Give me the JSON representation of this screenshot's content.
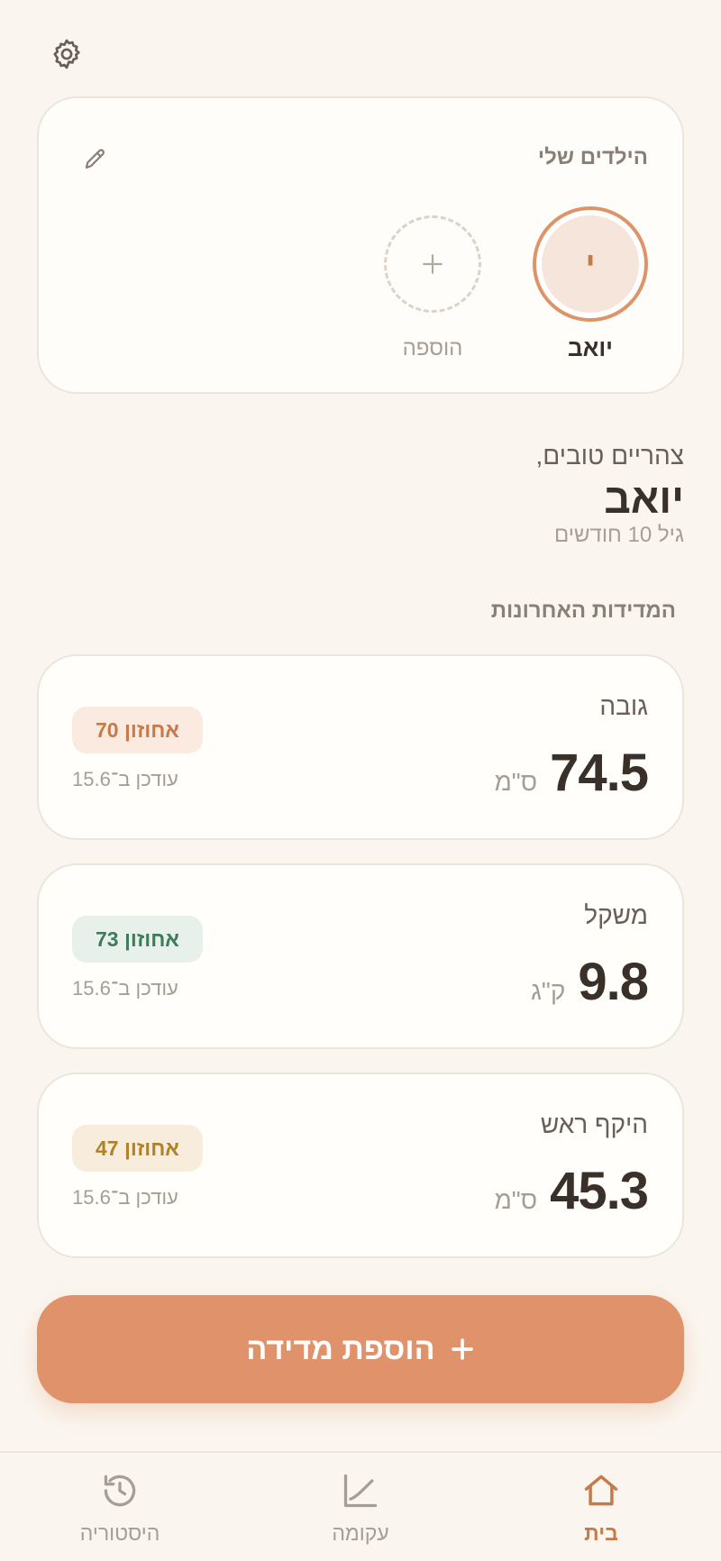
{
  "kids": {
    "title": "הילדים שלי",
    "items": [
      {
        "initial": "י",
        "name": "יואב",
        "selected": true
      }
    ],
    "add_label": "הוספה"
  },
  "greeting": {
    "salutation": "צהריים טובים,",
    "child_name": "יואב",
    "age": "גיל 10 חודשים"
  },
  "measurements": {
    "title": "המדידות האחרונות",
    "items": [
      {
        "label": "גובה",
        "value": "74.5",
        "unit": "ס\"מ",
        "percentile": "אחוזון 70",
        "updated": "עודכן ב־15.6",
        "badge_bg": "#fbeae0",
        "badge_color": "#c87949"
      },
      {
        "label": "משקל",
        "value": "9.8",
        "unit": "ק\"ג",
        "percentile": "אחוזון 73",
        "updated": "עודכן ב־15.6",
        "badge_bg": "#e7f0ea",
        "badge_color": "#3f7a5a"
      },
      {
        "label": "היקף ראש",
        "value": "45.3",
        "unit": "ס\"מ",
        "percentile": "אחוזון 47",
        "updated": "עודכן ב־15.6",
        "badge_bg": "#f8eddc",
        "badge_color": "#b08226"
      }
    ]
  },
  "add_measurement": {
    "label": "הוספת מדידה",
    "icon": "plus-icon"
  },
  "nav": {
    "items": [
      {
        "label": "בית",
        "icon": "home-icon",
        "active": true
      },
      {
        "label": "עקומה",
        "icon": "chart-icon",
        "active": false
      },
      {
        "label": "היסטוריה",
        "icon": "history-icon",
        "active": false
      }
    ]
  },
  "colors": {
    "background": "#faf6ef",
    "accent": "#e0926b",
    "accent_dark": "#c87949",
    "text": "#3a302a",
    "muted": "#a89d95"
  }
}
